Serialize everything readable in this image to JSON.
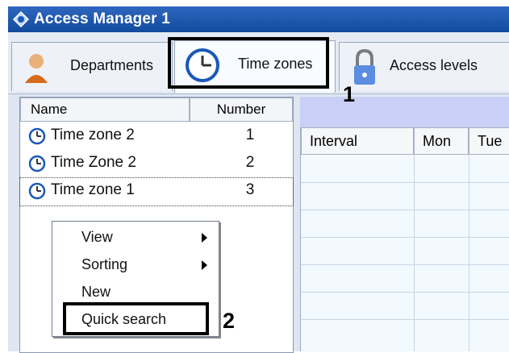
{
  "window": {
    "title": "Access Manager 1"
  },
  "tabs": [
    {
      "label": "Departments",
      "icon": "person-icon"
    },
    {
      "label": "Time zones",
      "icon": "clock-icon"
    },
    {
      "label": "Access levels",
      "icon": "lock-icon"
    }
  ],
  "annotations": {
    "tab_callout": "1",
    "menu_callout": "2"
  },
  "time_zone_list": {
    "columns": [
      "Name",
      "Number"
    ],
    "rows": [
      {
        "name": "Time zone 2",
        "number": "1"
      },
      {
        "name": "Time Zone 2",
        "number": "2"
      },
      {
        "name": "Time zone 1",
        "number": "3"
      }
    ]
  },
  "context_menu": {
    "items": [
      {
        "label": "View",
        "has_submenu": true
      },
      {
        "label": "Sorting",
        "has_submenu": true
      },
      {
        "label": "New",
        "has_submenu": false
      },
      {
        "label": "Quick search",
        "has_submenu": false
      }
    ]
  },
  "schedule_grid": {
    "columns": [
      "Interval",
      "Mon",
      "Tue"
    ]
  },
  "colors": {
    "titlebar": "#1f5bb4",
    "highlight_outline": "#000000",
    "right_pane": "#c9cff6"
  }
}
